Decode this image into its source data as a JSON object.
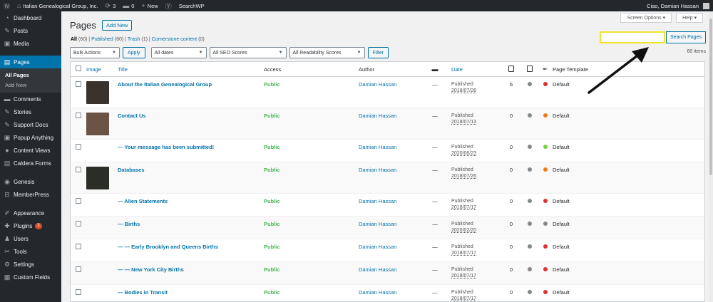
{
  "adminbar": {
    "site_name": "Italian Genealogical Group, Inc.",
    "updates_count": "3",
    "comments_count": "0",
    "new_label": "New",
    "searchwp_label": "SearchWP",
    "greeting": "Ciao, Damian Hassan"
  },
  "sidebar": {
    "items": [
      {
        "label": "Dashboard",
        "icon": "dashboard-icon",
        "glyph": "◔"
      },
      {
        "label": "Posts",
        "icon": "pin-icon",
        "glyph": "✎"
      },
      {
        "label": "Media",
        "icon": "media-icon",
        "glyph": "▣"
      },
      {
        "label": "Pages",
        "icon": "pages-icon",
        "glyph": "▤"
      },
      {
        "label": "Comments",
        "icon": "comments-icon",
        "glyph": "▬"
      },
      {
        "label": "Stories",
        "icon": "pin-icon",
        "glyph": "✎"
      },
      {
        "label": "Support Docs",
        "icon": "pin-icon",
        "glyph": "✎"
      },
      {
        "label": "Popup Anything",
        "icon": "popup-icon",
        "glyph": "▣"
      },
      {
        "label": "Content Views",
        "icon": "cv-icon",
        "glyph": "●"
      },
      {
        "label": "Caldera Forms",
        "icon": "forms-icon",
        "glyph": "▤"
      },
      {
        "label": "Genesis",
        "icon": "genesis-icon",
        "glyph": "◉"
      },
      {
        "label": "MemberPress",
        "icon": "memberpress-icon",
        "glyph": "⊟"
      },
      {
        "label": "Appearance",
        "icon": "appearance-icon",
        "glyph": "✐"
      },
      {
        "label": "Plugins",
        "icon": "plugins-icon",
        "glyph": "✚",
        "badge": "3"
      },
      {
        "label": "Users",
        "icon": "users-icon",
        "glyph": "♟"
      },
      {
        "label": "Tools",
        "icon": "tools-icon",
        "glyph": "✂"
      },
      {
        "label": "Settings",
        "icon": "settings-icon",
        "glyph": "⚙"
      },
      {
        "label": "Custom Fields",
        "icon": "fields-icon",
        "glyph": "▦"
      }
    ],
    "submenu": [
      "All Pages",
      "Add New"
    ]
  },
  "screen_options_label": "Screen Options",
  "help_label": "Help",
  "page_title": "Pages",
  "add_new_label": "Add New",
  "views": {
    "all": "All",
    "all_count": "(60)",
    "published": "Published",
    "published_count": "(60)",
    "trash": "Trash",
    "trash_count": "(1)",
    "cornerstone": "Cornerstone content",
    "cornerstone_count": "(0)"
  },
  "search": {
    "placeholder": "",
    "button": "Search Pages"
  },
  "filters": {
    "bulk_actions": "Bulk Actions",
    "apply": "Apply",
    "dates": "All dates",
    "seo": "All SEO Scores",
    "readability": "All Readability Scores",
    "filter": "Filter"
  },
  "items_count": "60 items",
  "columns": {
    "image": "Image",
    "title": "Title",
    "access": "Access",
    "author": "Author",
    "date": "Date",
    "template": "Page Template"
  },
  "colors": {
    "green": "#7ad03a",
    "orange": "#ee7c1b",
    "red": "#dc3232",
    "grey": "#888888",
    "highlight": "#f0e22f"
  },
  "rows": [
    {
      "title": "About the Italian Genealogical Group",
      "thumb": "#3a322c",
      "access": "Public",
      "author": "Damian Hassan",
      "comments": "—",
      "status": "Published",
      "date": "2018/07/26",
      "links": "6",
      "seo": "#888888",
      "read": "#dc3232",
      "template": "Default"
    },
    {
      "title": "Contact Us",
      "thumb": "#6b5446",
      "access": "Public",
      "author": "Damian Hassan",
      "comments": "—",
      "status": "Published",
      "date": "2018/07/13",
      "links": "0",
      "seo": "#888888",
      "read": "#ee7c1b",
      "template": "Default"
    },
    {
      "title": "— Your message has been submitted!",
      "thumb": "",
      "access": "Public",
      "author": "Damian Hassan",
      "comments": "—",
      "status": "Published",
      "date": "2020/06/23",
      "links": "0",
      "seo": "#888888",
      "read": "#7ad03a",
      "template": "Default"
    },
    {
      "title": "Databases",
      "thumb": "#2b2d27",
      "access": "Public",
      "author": "Damian Hassan",
      "comments": "—",
      "status": "Published",
      "date": "2018/07/26",
      "links": "0",
      "seo": "#888888",
      "read": "#ee7c1b",
      "template": "Default"
    },
    {
      "title": "— Alien Statements",
      "thumb": "",
      "access": "Public",
      "author": "Damian Hassan",
      "comments": "—",
      "status": "Published",
      "date": "2018/07/17",
      "links": "0",
      "seo": "#888888",
      "read": "#dc3232",
      "template": "Default"
    },
    {
      "title": "— Births",
      "thumb": "",
      "access": "Public",
      "author": "Damian Hassan",
      "comments": "—",
      "status": "Published",
      "date": "2020/02/20",
      "links": "0",
      "seo": "#888888",
      "read": "#888888",
      "template": "Default"
    },
    {
      "title": "— — Early Brooklyn and Queens Births",
      "thumb": "",
      "access": "Public",
      "author": "Damian Hassan",
      "comments": "—",
      "status": "Published",
      "date": "2018/07/17",
      "links": "0",
      "seo": "#888888",
      "read": "#dc3232",
      "template": "Default"
    },
    {
      "title": "— — New York City Births",
      "thumb": "",
      "access": "Public",
      "author": "Damian Hassan",
      "comments": "—",
      "status": "Published",
      "date": "2018/07/17",
      "links": "0",
      "seo": "#888888",
      "read": "#dc3232",
      "template": "Default"
    },
    {
      "title": "— Bodies in Transit",
      "thumb": "",
      "access": "Public",
      "author": "Damian Hassan",
      "comments": "—",
      "status": "Published",
      "date": "2018/07/17",
      "links": "0",
      "seo": "#888888",
      "read": "#dc3232",
      "template": "Default"
    }
  ]
}
